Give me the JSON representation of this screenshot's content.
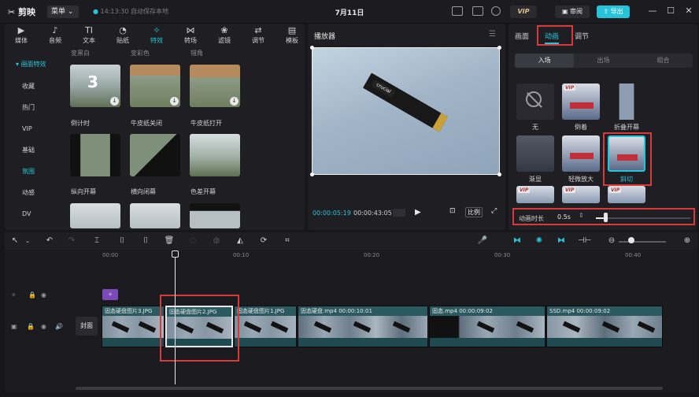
{
  "titlebar": {
    "logo": "剪映",
    "menu_label": "菜单",
    "save_status": "14:13:30 自动保存本地",
    "date": "7月11日",
    "vip_label": "VIP",
    "review_label": "审阅",
    "export_label": "导出",
    "minimize": "—",
    "maximize": "☐",
    "close": "✕"
  },
  "toolbar": [
    {
      "label": "媒体",
      "icon": "▶"
    },
    {
      "label": "音频",
      "icon": "♪"
    },
    {
      "label": "文本",
      "icon": "TI"
    },
    {
      "label": "贴纸",
      "icon": "◔"
    },
    {
      "label": "特效",
      "icon": "✧"
    },
    {
      "label": "转场",
      "icon": "⋈"
    },
    {
      "label": "滤镜",
      "icon": "❀"
    },
    {
      "label": "调节",
      "icon": "⇄"
    },
    {
      "label": "模板",
      "icon": "▤"
    }
  ],
  "categories": [
    "画面特效",
    "收藏",
    "热门",
    "VIP",
    "基础",
    "氛围",
    "动感",
    "DV"
  ],
  "effects": {
    "top_labels": [
      "变黑白",
      "变彩色",
      "错角"
    ],
    "items": [
      {
        "label": "倒计时",
        "badge": "3"
      },
      {
        "label": "牛皮纸关闭"
      },
      {
        "label": "牛皮纸打开"
      },
      {
        "label": "纵向开幕"
      },
      {
        "label": "横向闭幕"
      },
      {
        "label": "色差开幕"
      }
    ],
    "download_icon": "↓"
  },
  "player": {
    "title": "播放器",
    "menu_icon": "☰",
    "ssd_brand": "crucial",
    "current_time": "00:00:05:19",
    "total_time": "00:00:43:05",
    "play_icon": "▶",
    "ratio_label": "比例",
    "fit_icon": "⊡",
    "fullscreen_icon": "⤢"
  },
  "right_panel": {
    "tabs": [
      "画面",
      "动画",
      "调节"
    ],
    "subtabs": [
      "入场",
      "出场",
      "组合"
    ],
    "animations": [
      {
        "label": "无"
      },
      {
        "label": "倒着",
        "vip": true
      },
      {
        "label": "折叠开幕"
      },
      {
        "label": "渐显"
      },
      {
        "label": "轻微放大"
      },
      {
        "label": "斜切"
      }
    ],
    "vip_tag": "VIP",
    "duration_label": "动画时长",
    "duration_value": "0.5s",
    "duration_fraction": 0.1
  },
  "timeline": {
    "ruler": [
      "00:00",
      "00:10",
      "00:20",
      "00:30",
      "00:40"
    ],
    "cover_label": "封面",
    "clips": [
      {
        "name": "固态硬盘图片3.JPG"
      },
      {
        "name": "固态硬盘图片2.JPG"
      },
      {
        "name": "固态硬盘图片1.JPG"
      },
      {
        "name": "固态硬盘.mp4",
        "duration": "00:00:10:01"
      },
      {
        "name": "固态.mp4",
        "duration": "00:00:09:02"
      },
      {
        "name": "SSD.mp4",
        "duration": "00:00:09:02"
      }
    ]
  }
}
